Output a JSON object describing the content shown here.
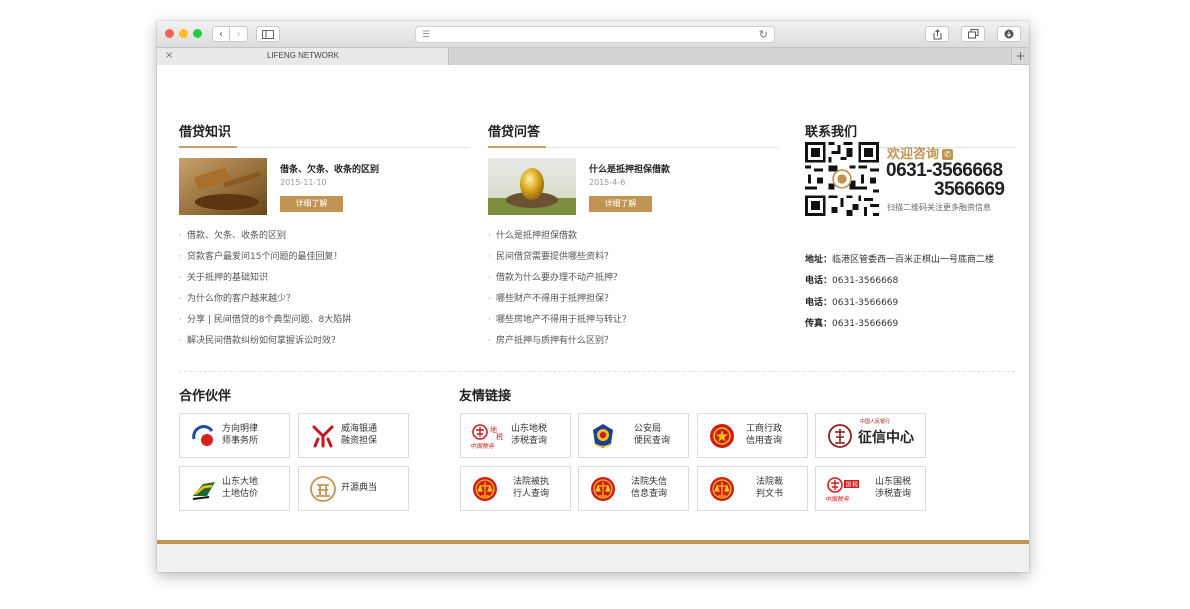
{
  "browser": {
    "tab_title": "LIFENG NETWORK",
    "tab_close": "×",
    "new_tab": "+"
  },
  "knowledge": {
    "title": "借贷知识",
    "featured": {
      "title": "借条、欠条、收条的区别",
      "date": "2015-11-10",
      "button": "详细了解"
    },
    "items": [
      "借款、欠条、收条的区别",
      "贷款客户最爱问15个问题的最佳回复！",
      "关于抵押的基础知识",
      "为什么你的客户越来越少？",
      "分享 | 民间借贷的8个典型问题、8大陷阱",
      "解决民间借款纠纷如何掌握诉讼时效？"
    ]
  },
  "qa": {
    "title": "借贷问答",
    "featured": {
      "title": "什么是抵押担保借款",
      "date": "2015-4-6",
      "button": "详细了解"
    },
    "items": [
      "什么是抵押担保借款",
      "民间借贷需要提供哪些资料？",
      "借款为什么要办理不动产抵押？",
      "哪些财产不得用于抵押担保？",
      "哪些房地产不得用于抵押与转让？",
      "房产抵押与质押有什么区别？"
    ]
  },
  "contact": {
    "title": "联系我们",
    "consult": "欢迎咨询",
    "phone_big_1": "0631-3566668",
    "phone_big_2": "3566669",
    "qr_note": "扫描二维码关注更多融资信息",
    "rows": [
      {
        "label": "地址：",
        "value": "临港区管委西一百米正棋山一号底商二楼"
      },
      {
        "label": "电话：",
        "value": "0631-3566668"
      },
      {
        "label": "电话：",
        "value": "0631-3566669"
      },
      {
        "label": "传真：",
        "value": "0631-3566669"
      }
    ]
  },
  "partners": {
    "title": "合作伙伴",
    "items": [
      {
        "line1": "方向明律",
        "line2": "师事务所"
      },
      {
        "line1": "威海银通",
        "line2": "融资担保"
      },
      {
        "line1": "山东大地",
        "line2": "土地估价"
      },
      {
        "line1": "开源典当",
        "line2": ""
      }
    ]
  },
  "links": {
    "title": "友情链接",
    "items": [
      {
        "line1": "山东地税",
        "line2": "涉税查询"
      },
      {
        "line1": "公安局",
        "line2": "便民查询"
      },
      {
        "line1": "工商行政",
        "line2": "信用查询"
      },
      {
        "line1": "征信中心",
        "line2": "",
        "top_text": "中国人民银行"
      },
      {
        "line1": "法院被执",
        "line2": "行人查询"
      },
      {
        "line1": "法院失信",
        "line2": "信息查询"
      },
      {
        "line1": "法院裁",
        "line2": "判文书"
      },
      {
        "line1": "山东国税",
        "line2": "涉税查询"
      }
    ],
    "seal_text": {
      "di": "地",
      "shui": "税",
      "guo": "国",
      "zhongguo": "中国税务"
    }
  }
}
